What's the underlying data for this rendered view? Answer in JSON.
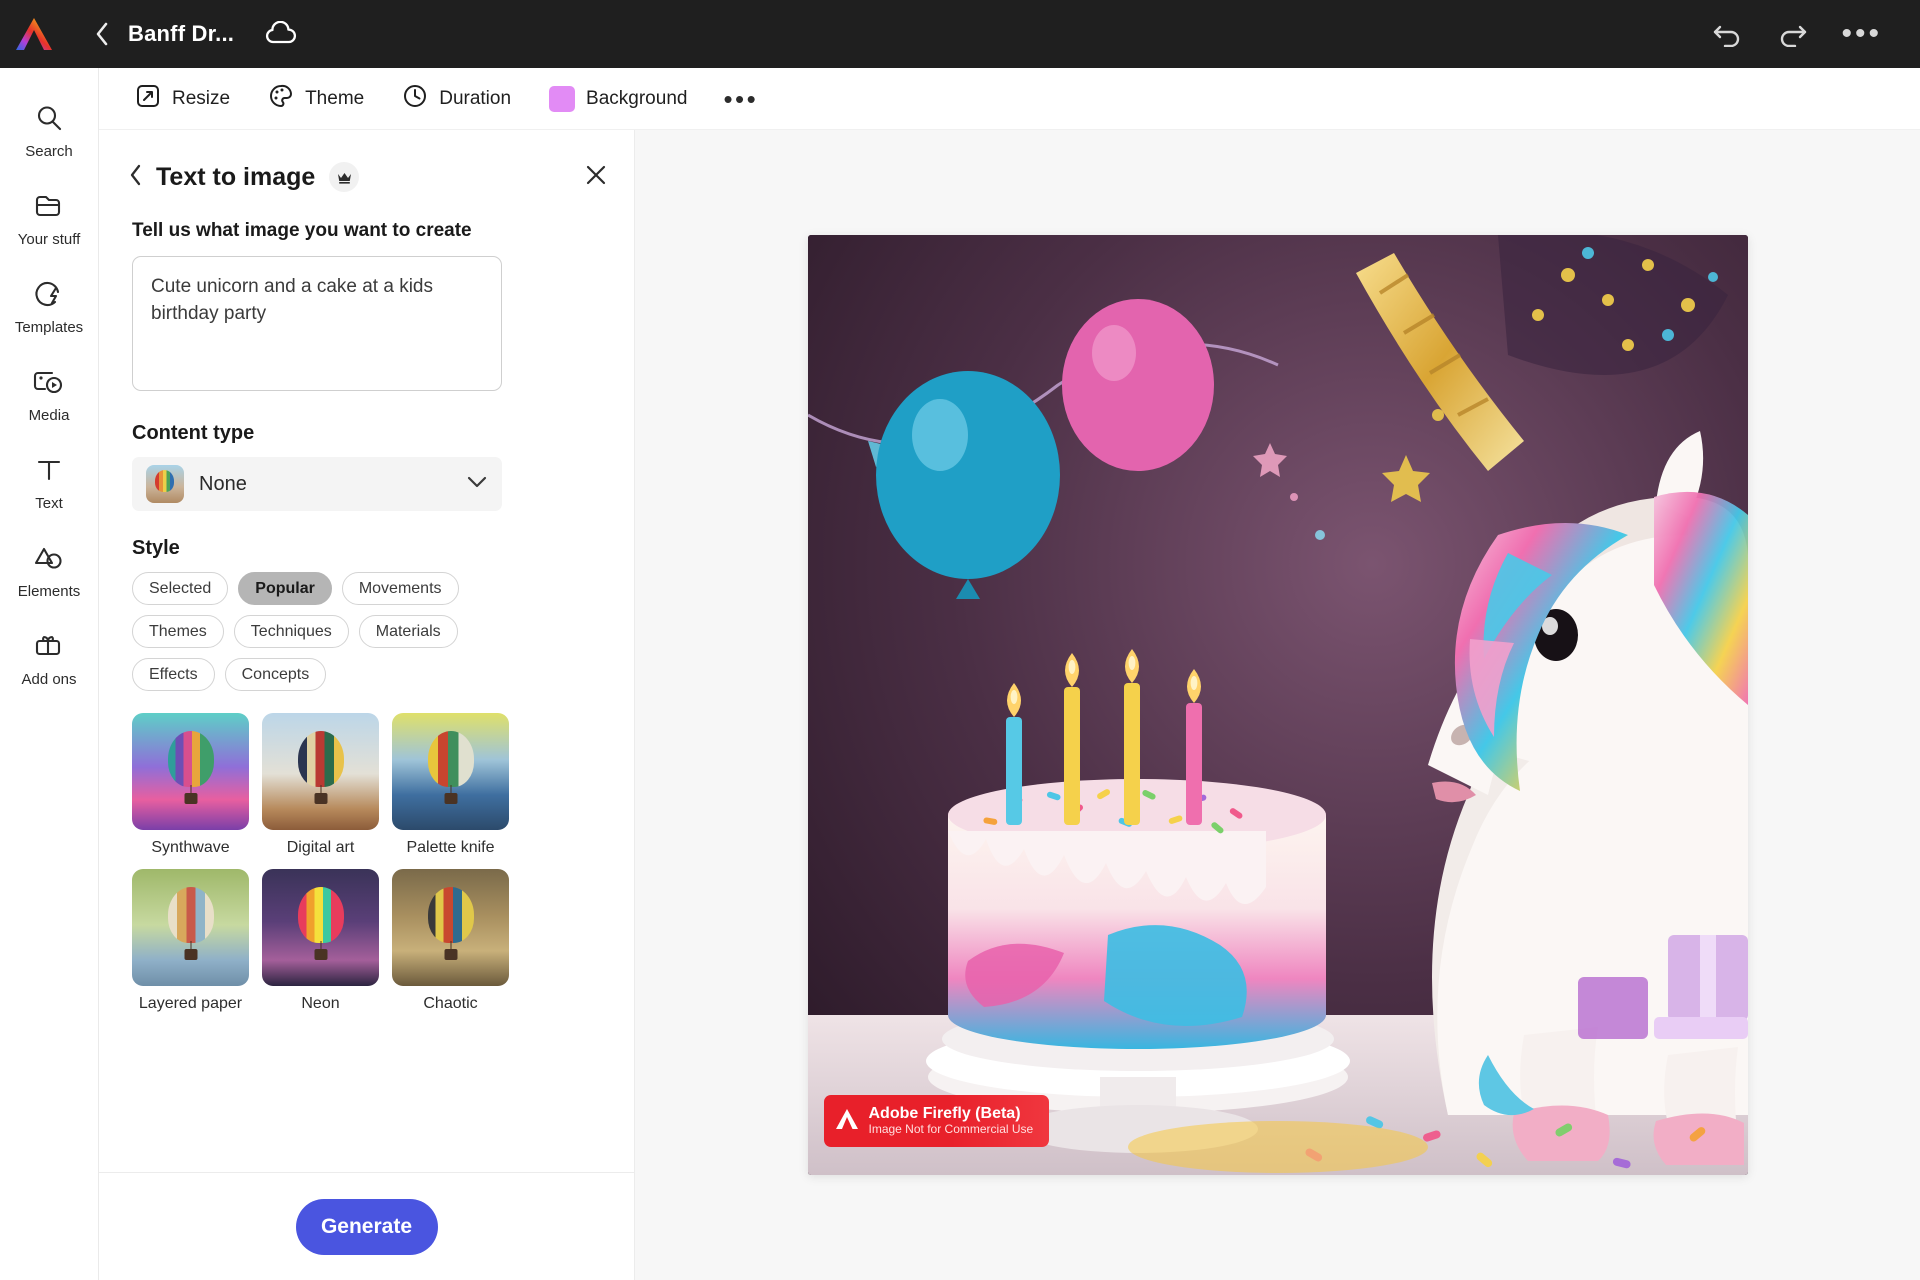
{
  "topbar": {
    "logo_icon": "adobe-express-logo-icon",
    "back_icon": "chevron-left-icon",
    "doc_title": "Banff Dr...",
    "cloud_icon": "cloud-saved-icon",
    "undo_icon": "undo-icon",
    "redo_icon": "redo-icon",
    "more_icon": "more-options-icon",
    "more_label": "•••"
  },
  "sidebar": {
    "items": [
      {
        "label": "Search",
        "icon": "search-icon"
      },
      {
        "label": "Your stuff",
        "icon": "folder-icon"
      },
      {
        "label": "Templates",
        "icon": "templates-icon"
      },
      {
        "label": "Media",
        "icon": "media-icon"
      },
      {
        "label": "Text",
        "icon": "text-icon"
      },
      {
        "label": "Elements",
        "icon": "elements-icon"
      },
      {
        "label": "Add ons",
        "icon": "add-ons-icon"
      }
    ]
  },
  "doc_toolbar": {
    "resize_label": "Resize",
    "theme_label": "Theme",
    "duration_label": "Duration",
    "background_label": "Background",
    "background_color": "#e28bf5",
    "more_label": "•••"
  },
  "panel": {
    "back_icon": "chevron-left-icon",
    "title": "Text to image",
    "premium_badge_icon": "crown-icon",
    "close_icon": "close-icon",
    "prompt": {
      "label": "Tell us what image you want to create",
      "value": "Cute unicorn and a cake at a kids birthday party",
      "placeholder": "Tell us what image you want to create"
    },
    "content_type": {
      "label": "Content type",
      "selected": "None",
      "chevron_icon": "chevron-down-icon",
      "thumb_icon": "hot-air-balloon-thumb"
    },
    "style": {
      "label": "Style",
      "chips": [
        {
          "label": "Selected",
          "selected": false
        },
        {
          "label": "Popular",
          "selected": true
        },
        {
          "label": "Movements",
          "selected": false
        },
        {
          "label": "Themes",
          "selected": false
        },
        {
          "label": "Techniques",
          "selected": false
        },
        {
          "label": "Materials",
          "selected": false
        },
        {
          "label": "Effects",
          "selected": false
        },
        {
          "label": "Concepts",
          "selected": false
        }
      ],
      "presets": [
        {
          "name": "Synthwave"
        },
        {
          "name": "Digital art"
        },
        {
          "name": "Palette knife"
        },
        {
          "name": "Layered paper"
        },
        {
          "name": "Neon"
        },
        {
          "name": "Chaotic"
        }
      ]
    },
    "generate_label": "Generate",
    "generate_color": "#4a55e0"
  },
  "canvas": {
    "watermark_title": "Adobe Firefly (Beta)",
    "watermark_subtitle": "Image Not for Commercial Use",
    "watermark_icon": "adobe-logo-icon"
  }
}
